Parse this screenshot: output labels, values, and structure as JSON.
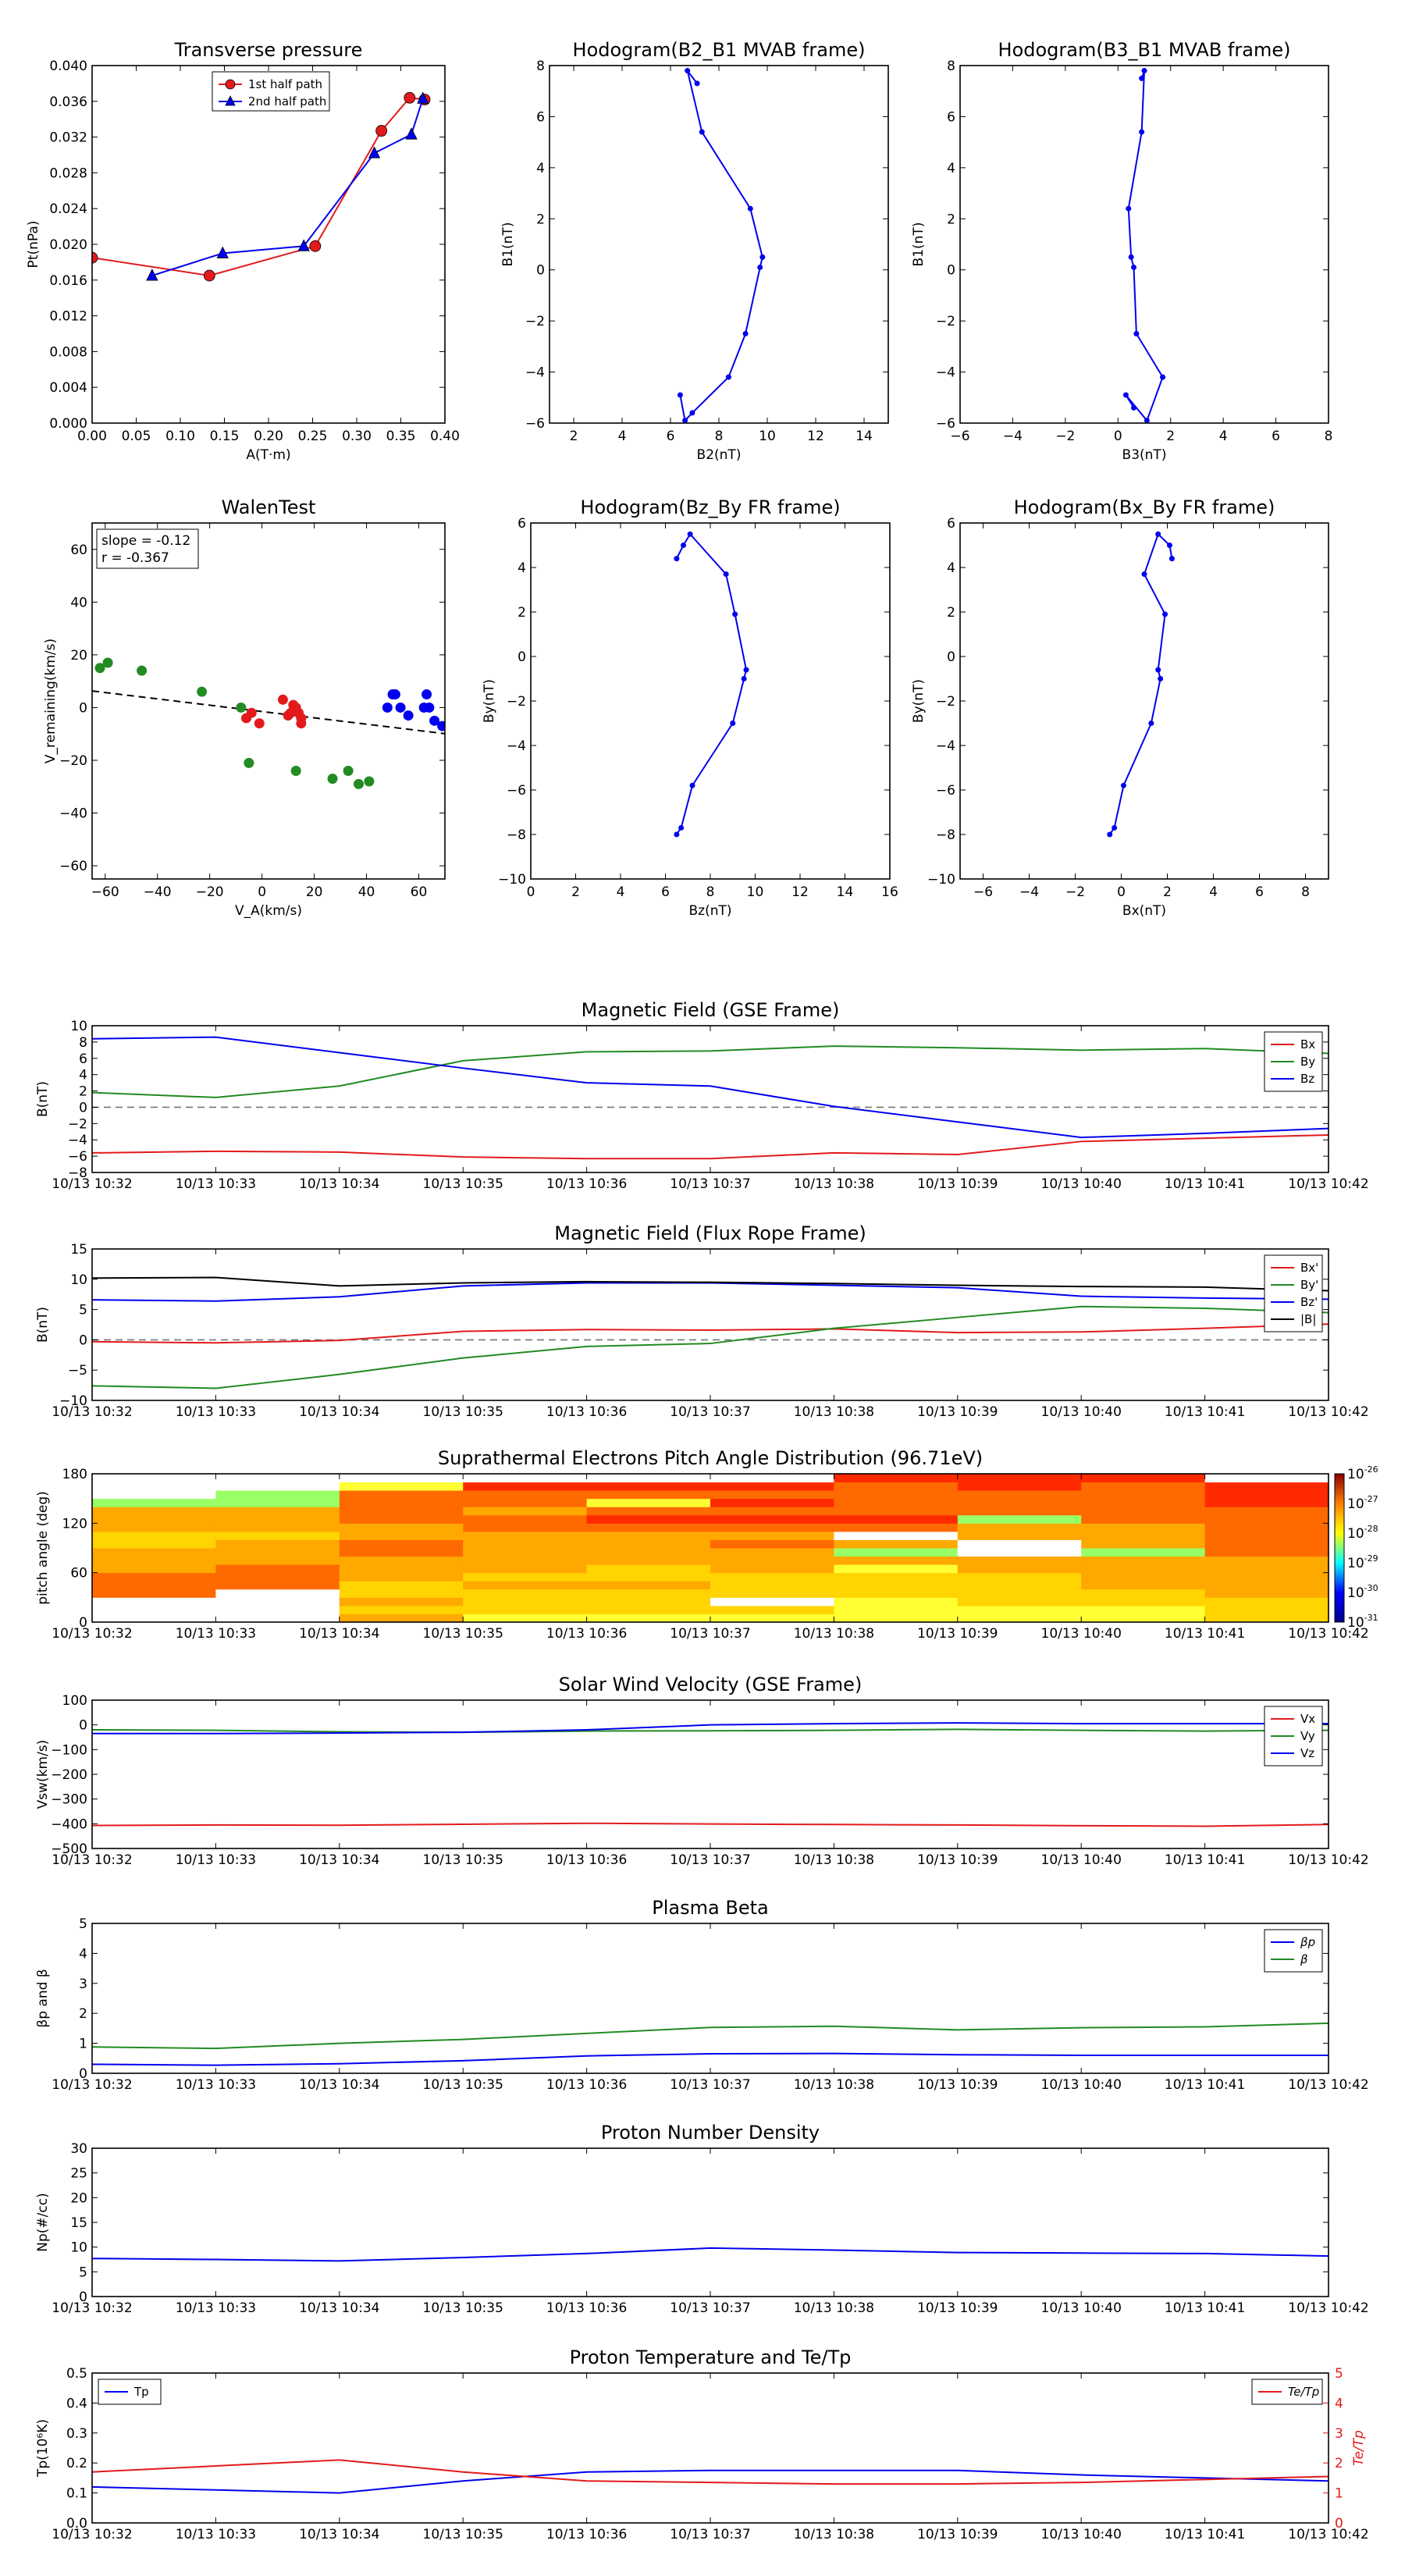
{
  "colors": {
    "red": "#e31a1c",
    "green": "#228b22",
    "blue": "#0000ee",
    "black": "#000000",
    "ratio_axis": "#e31a1c"
  },
  "chart_data": [
    {
      "id": "transverse_pressure",
      "type": "line",
      "title": "Transverse pressure",
      "xlabel": "A(T·m)",
      "ylabel": "Pt(nPa)",
      "xlim": [
        0,
        0.4
      ],
      "ylim": [
        0,
        0.04
      ],
      "xticks": [
        "0.00",
        "0.05",
        "0.10",
        "0.15",
        "0.20",
        "0.25",
        "0.30",
        "0.35",
        "0.40"
      ],
      "yticks": [
        "0.000",
        "0.004",
        "0.008",
        "0.012",
        "0.016",
        "0.020",
        "0.024",
        "0.028",
        "0.032",
        "0.036",
        "0.040"
      ],
      "legend": {
        "position": "top-center"
      },
      "series": [
        {
          "name": "1st half path",
          "color": "#e31a1c",
          "marker": "circle",
          "x": [
            0.0,
            0.133,
            0.253,
            0.328,
            0.36,
            0.377
          ],
          "y": [
            0.0185,
            0.0165,
            0.0198,
            0.0327,
            0.0364,
            0.0362
          ]
        },
        {
          "name": "2nd half path",
          "color": "#0000ee",
          "marker": "triangle",
          "x": [
            0.068,
            0.148,
            0.24,
            0.32,
            0.362,
            0.375
          ],
          "y": [
            0.0165,
            0.019,
            0.0198,
            0.0302,
            0.0323,
            0.0363
          ]
        }
      ]
    },
    {
      "id": "hodogram_b2_b1",
      "type": "line",
      "title": "Hodogram(B2_B1 MVAB frame)",
      "xlabel": "B2(nT)",
      "ylabel": "B1(nT)",
      "xlim": [
        1,
        15
      ],
      "ylim": [
        -6,
        8
      ],
      "xticks": [
        "2",
        "4",
        "6",
        "8",
        "10",
        "12",
        "14"
      ],
      "yticks": [
        "−6",
        "−4",
        "−2",
        "0",
        "2",
        "4",
        "6",
        "8"
      ],
      "series": [
        {
          "color": "#0000ee",
          "marker": "dot",
          "x": [
            7.1,
            6.7,
            7.3,
            9.3,
            9.8,
            9.7,
            9.1,
            8.4,
            6.9,
            6.6,
            6.4
          ],
          "y": [
            7.3,
            7.8,
            5.4,
            2.4,
            0.5,
            0.1,
            -2.5,
            -4.2,
            -5.6,
            -5.9,
            -4.9
          ]
        }
      ]
    },
    {
      "id": "hodogram_b3_b1",
      "type": "line",
      "title": "Hodogram(B3_B1 MVAB frame)",
      "xlabel": "B3(nT)",
      "ylabel": "B1(nT)",
      "xlim": [
        -6,
        8
      ],
      "ylim": [
        -6,
        8
      ],
      "xticks": [
        "−6",
        "−4",
        "−2",
        "0",
        "4",
        "2",
        "6",
        "8"
      ],
      "yticks": [
        "−6",
        "−4",
        "−2",
        "0",
        "2",
        "4",
        "6",
        "8"
      ],
      "series": [
        {
          "color": "#0000ee",
          "marker": "dot",
          "x": [
            0.9,
            1.0,
            0.9,
            0.4,
            0.5,
            0.6,
            0.7,
            1.7,
            1.1,
            0.3,
            0.6
          ],
          "y": [
            7.5,
            7.8,
            5.4,
            2.4,
            0.5,
            0.1,
            -2.5,
            -4.2,
            -5.9,
            -4.9,
            -5.4
          ]
        }
      ]
    },
    {
      "id": "walen_test",
      "type": "scatter",
      "title": "WalenTest",
      "xlabel": "V_A(km/s)",
      "ylabel": "V_remaining(km/s)",
      "xlim": [
        -65,
        70
      ],
      "ylim": [
        -65,
        70
      ],
      "xticks": [
        "−60",
        "−40",
        "−20",
        "0",
        "20",
        "40",
        "60"
      ],
      "yticks": [
        "−60",
        "−40",
        "−20",
        "0",
        "20",
        "40",
        "60"
      ],
      "annotation": [
        "slope = -0.12",
        "r = -0.367"
      ],
      "fit_line": {
        "slope": -0.12,
        "intercept": -1.5,
        "style": "dashed"
      },
      "series": [
        {
          "color": "#228b22",
          "x": [
            -62,
            -59,
            -46,
            -23,
            -8,
            -5,
            13,
            27,
            33,
            37,
            41
          ],
          "y": [
            15,
            17,
            14,
            6,
            0,
            -21,
            -24,
            -27,
            -24,
            -29,
            -28
          ]
        },
        {
          "color": "#e31a1c",
          "x": [
            -6,
            -4,
            -1,
            8,
            10,
            11,
            12,
            13,
            14,
            15,
            15
          ],
          "y": [
            -4,
            -2,
            -6,
            3,
            -3,
            -2,
            1,
            0,
            -2,
            -4,
            -6
          ]
        },
        {
          "color": "#0000ee",
          "x": [
            48,
            50,
            51,
            53,
            56,
            62,
            63,
            64,
            66,
            69
          ],
          "y": [
            0,
            5,
            5,
            0,
            -3,
            0,
            5,
            0,
            -5,
            -7
          ]
        }
      ]
    },
    {
      "id": "hodogram_bz_by",
      "type": "line",
      "title": "Hodogram(Bz_By FR frame)",
      "xlabel": "Bz(nT)",
      "ylabel": "By(nT)",
      "xlim": [
        0,
        16
      ],
      "ylim": [
        -10,
        6
      ],
      "xticks": [
        "0",
        "2",
        "4",
        "6",
        "8",
        "10",
        "12",
        "14",
        "16"
      ],
      "yticks": [
        "−10",
        "−8",
        "−6",
        "−4",
        "−2",
        "0",
        "2",
        "4",
        "6"
      ],
      "series": [
        {
          "color": "#0000ee",
          "marker": "dot",
          "x": [
            6.5,
            6.8,
            7.1,
            8.7,
            9.1,
            9.6,
            9.5,
            9.0,
            7.2,
            6.7,
            6.5
          ],
          "y": [
            4.4,
            5.0,
            5.5,
            3.7,
            1.9,
            -0.6,
            -1.0,
            -3.0,
            -5.8,
            -7.7,
            -8.0
          ]
        }
      ]
    },
    {
      "id": "hodogram_bx_by",
      "type": "line",
      "title": "Hodogram(Bx_By FR frame)",
      "xlabel": "Bx(nT)",
      "ylabel": "By(nT)",
      "xlim": [
        -7,
        9
      ],
      "ylim": [
        -10,
        6
      ],
      "xticks": [
        "−6",
        "−4",
        "−2",
        "0",
        "2",
        "4",
        "6",
        "8"
      ],
      "yticks": [
        "−10",
        "−8",
        "−6",
        "−4",
        "−2",
        "0",
        "2",
        "4",
        "6"
      ],
      "series": [
        {
          "color": "#0000ee",
          "marker": "dot",
          "x": [
            2.2,
            2.1,
            1.6,
            1.0,
            1.9,
            1.6,
            1.7,
            1.3,
            0.1,
            -0.3,
            -0.5
          ],
          "y": [
            4.4,
            5.0,
            5.5,
            3.7,
            1.9,
            -0.6,
            -1.0,
            -3.0,
            -5.8,
            -7.7,
            -8.0
          ]
        }
      ]
    }
  ],
  "time_axis": [
    "10/13 10:32",
    "10/13 10:33",
    "10/13 10:34",
    "10/13 10:35",
    "10/13 10:36",
    "10/13 10:37",
    "10/13 10:38",
    "10/13 10:39",
    "10/13 10:40",
    "10/13 10:41",
    "10/13 10:42"
  ],
  "timeseries": [
    {
      "id": "mag_gse",
      "title": "Magnetic Field (GSE Frame)",
      "ylabel": "B(nT)",
      "ylim": [
        -8,
        10
      ],
      "yticks": [
        "−8",
        "−6",
        "−4",
        "−2",
        "0",
        "2",
        "4",
        "6",
        "8",
        "10"
      ],
      "zero_line": true,
      "series": [
        {
          "name": "Bx",
          "color": "#e31a1c",
          "values": [
            -5.6,
            -5.4,
            -5.5,
            -6.1,
            -6.3,
            -6.3,
            -5.6,
            -5.8,
            -4.2,
            -3.8,
            -3.4
          ]
        },
        {
          "name": "By",
          "color": "#228b22",
          "values": [
            1.8,
            1.2,
            2.6,
            5.7,
            6.8,
            6.9,
            7.5,
            7.3,
            7.0,
            7.2,
            6.6
          ]
        },
        {
          "name": "Bz",
          "color": "#0000ee",
          "values": [
            8.4,
            8.6,
            6.7,
            4.8,
            3.0,
            2.6,
            0.1,
            -1.8,
            -3.7,
            -3.2,
            -2.6
          ]
        }
      ]
    },
    {
      "id": "mag_fr",
      "title": "Magnetic Field (Flux Rope Frame)",
      "ylabel": "B(nT)",
      "ylim": [
        -10,
        15
      ],
      "yticks": [
        "−10",
        "−5",
        "0",
        "5",
        "10",
        "15"
      ],
      "zero_line": true,
      "series": [
        {
          "name": "Bx'",
          "color": "#e31a1c",
          "values": [
            -0.3,
            -0.5,
            -0.1,
            1.4,
            1.7,
            1.6,
            1.8,
            1.2,
            1.3,
            1.9,
            2.6
          ]
        },
        {
          "name": "By'",
          "color": "#228b22",
          "values": [
            -7.6,
            -8.0,
            -5.7,
            -3.0,
            -1.1,
            -0.6,
            1.9,
            3.7,
            5.5,
            5.2,
            4.5
          ]
        },
        {
          "name": "Bz'",
          "color": "#0000ee",
          "values": [
            6.6,
            6.4,
            7.1,
            8.9,
            9.4,
            9.4,
            9.0,
            8.6,
            7.2,
            6.9,
            6.7
          ]
        },
        {
          "name": "|B|",
          "color": "#000000",
          "values": [
            10.2,
            10.3,
            8.9,
            9.4,
            9.6,
            9.5,
            9.3,
            9.0,
            8.8,
            8.7,
            8.1
          ]
        }
      ]
    },
    {
      "id": "pad",
      "type": "heatmap",
      "title": "Suprathermal Electrons Pitch Angle Distribution (96.71eV)",
      "ylabel": "pitch angle (deg)",
      "ylim": [
        0,
        180
      ],
      "yticks": [
        "0",
        "60",
        "120",
        "180"
      ],
      "colorbar": {
        "ticks": [
          "10",
          "10",
          "10",
          "10",
          "10",
          "10"
        ],
        "exponents": [
          "-31",
          "-30",
          "-29",
          "-28",
          "-27",
          "-26"
        ]
      },
      "columns": [
        [
          0,
          0,
          0,
          2,
          2,
          2,
          3,
          3,
          3,
          4,
          4,
          3,
          3,
          3,
          6,
          0,
          0,
          0
        ],
        [
          0,
          0,
          0,
          0,
          2,
          2,
          2,
          3,
          3,
          3,
          4,
          3,
          3,
          3,
          6,
          6,
          0,
          0
        ],
        [
          3,
          4,
          3,
          4,
          4,
          3,
          3,
          3,
          2,
          2,
          3,
          3,
          2,
          2,
          2,
          2,
          5,
          0
        ],
        [
          5,
          4,
          4,
          4,
          3,
          4,
          3,
          3,
          3,
          3,
          3,
          2,
          2,
          3,
          2,
          2,
          1,
          0
        ],
        [
          5,
          4,
          4,
          4,
          3,
          4,
          4,
          3,
          3,
          3,
          3,
          2,
          1,
          2,
          5,
          2,
          1,
          0
        ],
        [
          5,
          4,
          0,
          4,
          4,
          4,
          3,
          3,
          3,
          2,
          3,
          2,
          1,
          2,
          1,
          2,
          1,
          0
        ],
        [
          5,
          5,
          5,
          4,
          4,
          4,
          5,
          3,
          6,
          3,
          0,
          2,
          1,
          2,
          2,
          2,
          2,
          1
        ],
        [
          5,
          5,
          4,
          4,
          4,
          4,
          3,
          3,
          0,
          0,
          3,
          3,
          6,
          2,
          2,
          2,
          1,
          1
        ],
        [
          5,
          5,
          4,
          4,
          3,
          3,
          3,
          3,
          6,
          3,
          3,
          3,
          2,
          2,
          2,
          2,
          2,
          1
        ],
        [
          4,
          4,
          4,
          3,
          3,
          3,
          3,
          3,
          2,
          2,
          2,
          2,
          2,
          2,
          1,
          1,
          1,
          0
        ]
      ]
    },
    {
      "id": "vsw",
      "title": "Solar Wind Velocity (GSE Frame)",
      "ylabel": "Vsw(km/s)",
      "ylim": [
        -500,
        100
      ],
      "yticks": [
        "−500",
        "−400",
        "−300",
        "−200",
        "−100",
        "0",
        "100"
      ],
      "series": [
        {
          "name": "Vx",
          "color": "#e31a1c",
          "values": [
            -407,
            -405,
            -406,
            -402,
            -398,
            -401,
            -403,
            -405,
            -408,
            -410,
            -403
          ]
        },
        {
          "name": "Vy",
          "color": "#228b22",
          "values": [
            -20,
            -22,
            -28,
            -30,
            -25,
            -24,
            -22,
            -18,
            -22,
            -25,
            -22
          ]
        },
        {
          "name": "Vz",
          "color": "#0000ee",
          "values": [
            -35,
            -35,
            -33,
            -30,
            -20,
            0,
            5,
            8,
            5,
            5,
            5
          ]
        }
      ]
    },
    {
      "id": "beta",
      "title": "Plasma Beta",
      "ylabel": "βp and β",
      "ylim": [
        0,
        5
      ],
      "yticks": [
        "0",
        "1",
        "2",
        "3",
        "4",
        "5"
      ],
      "series": [
        {
          "name": "βp",
          "color": "#0000ee",
          "values": [
            0.3,
            0.27,
            0.32,
            0.42,
            0.58,
            0.65,
            0.66,
            0.62,
            0.6,
            0.6,
            0.6
          ]
        },
        {
          "name": "β",
          "color": "#228b22",
          "values": [
            0.88,
            0.83,
            1.0,
            1.13,
            1.33,
            1.53,
            1.57,
            1.45,
            1.52,
            1.55,
            1.67
          ]
        }
      ]
    },
    {
      "id": "density",
      "title": "Proton Number Density",
      "ylabel": "Np(#/cc)",
      "ylim": [
        0,
        30
      ],
      "yticks": [
        "0",
        "5",
        "10",
        "15",
        "20",
        "25",
        "30"
      ],
      "series": [
        {
          "name": "Np",
          "color": "#0000ee",
          "values": [
            7.7,
            7.5,
            7.2,
            7.9,
            8.7,
            9.8,
            9.4,
            8.9,
            8.8,
            8.7,
            8.2
          ]
        }
      ]
    },
    {
      "id": "temperature",
      "title": "Proton Temperature and Te/Tp",
      "ylabel": "Tp(10⁶K)",
      "y2label": "Te/Tp",
      "ylim": [
        0,
        0.5
      ],
      "y2lim": [
        0,
        5
      ],
      "yticks": [
        "0.0",
        "0.1",
        "0.2",
        "0.3",
        "0.4",
        "0.5"
      ],
      "y2ticks": [
        "0",
        "1",
        "2",
        "3",
        "4",
        "5"
      ],
      "series": [
        {
          "name": "Tp",
          "color": "#0000ee",
          "axis": "left",
          "values": [
            0.12,
            0.11,
            0.1,
            0.14,
            0.17,
            0.175,
            0.175,
            0.175,
            0.16,
            0.15,
            0.14
          ]
        },
        {
          "name": "Te/Tp",
          "color": "#e31a1c",
          "axis": "right",
          "values": [
            1.7,
            1.9,
            2.1,
            1.7,
            1.4,
            1.35,
            1.3,
            1.3,
            1.35,
            1.45,
            1.55
          ]
        }
      ]
    }
  ]
}
